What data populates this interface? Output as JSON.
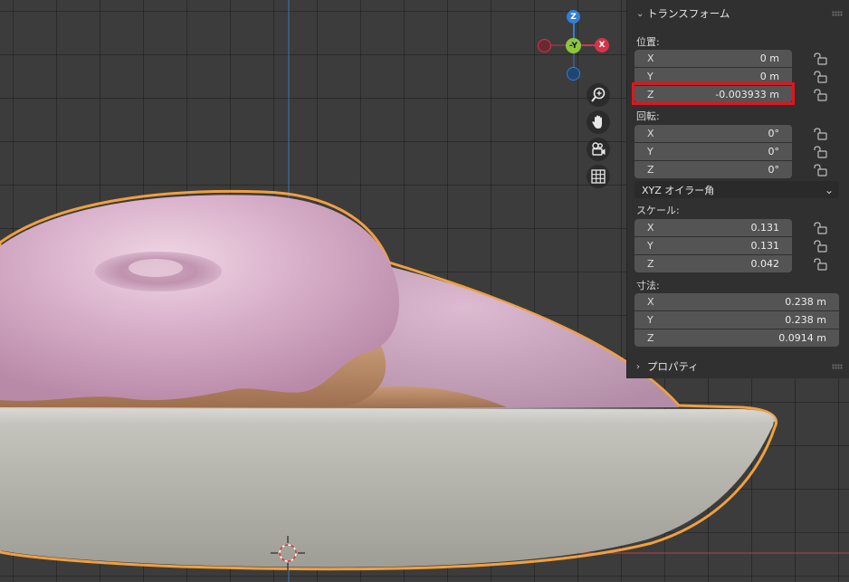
{
  "viewport": {
    "gizmo": {
      "z_label": "Z",
      "neg_y_label": "-Y",
      "x_label": "X"
    },
    "nav_icons": [
      "zoom-icon",
      "hand-pan-icon",
      "camera-icon",
      "grid-icon"
    ],
    "colors": {
      "x_axis": "#d8334a",
      "y_axis": "#8cc63f",
      "z_axis": "#2f7fd6",
      "selection_outline": "#f0a040",
      "frosting": "#d4a8c4",
      "plate": "#bdbcb6"
    }
  },
  "panel": {
    "transform_header": "トランスフォーム",
    "location_label": "位置:",
    "location": [
      {
        "axis": "X",
        "value": "0 m"
      },
      {
        "axis": "Y",
        "value": "0 m"
      },
      {
        "axis": "Z",
        "value": "-0.003933 m"
      }
    ],
    "rotation_label": "回転:",
    "rotation": [
      {
        "axis": "X",
        "value": "0°"
      },
      {
        "axis": "Y",
        "value": "0°"
      },
      {
        "axis": "Z",
        "value": "0°"
      }
    ],
    "rotation_mode": "XYZ オイラー角",
    "scale_label": "スケール:",
    "scale": [
      {
        "axis": "X",
        "value": "0.131"
      },
      {
        "axis": "Y",
        "value": "0.131"
      },
      {
        "axis": "Z",
        "value": "0.042"
      }
    ],
    "dimensions_label": "寸法:",
    "dimensions": [
      {
        "axis": "X",
        "value": "0.238 m"
      },
      {
        "axis": "Y",
        "value": "0.238 m"
      },
      {
        "axis": "Z",
        "value": "0.0914 m"
      }
    ],
    "properties_header": "プロパティ",
    "highlight_color": "#e0151e"
  }
}
